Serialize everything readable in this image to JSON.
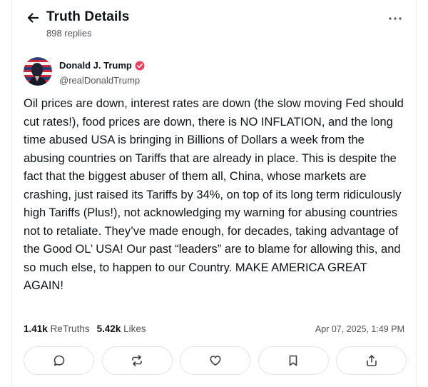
{
  "header": {
    "title": "Truth Details",
    "replies": "898 replies"
  },
  "author": {
    "name": "Donald J. Trump",
    "handle": "@realDonaldTrump",
    "verified": true
  },
  "post": {
    "text": "Oil prices are down, interest rates are down (the slow moving Fed should cut rates!), food prices are down, there is NO INFLATION, and the long time abused USA is bringing in Billions of Dollars a week from the abusing countries on Tariffs that are already in place. This is despite the fact that the biggest abuser of them all, China, whose markets are crashing, just raised its Tariffs by 34%, on top of its long term ridiculously high Tariffs (Plus!), not acknowledging my warning for abusing countries not to retaliate. They’ve made enough, for decades, taking advantage of the Good OL’ USA! Our past “leaders” are to blame for allowing this, and so much else, to happen to our Country. MAKE AMERICA GREAT AGAIN!"
  },
  "stats": {
    "retruths_count": "1.41k",
    "retruths_label": "ReTruths",
    "likes_count": "5.42k",
    "likes_label": "Likes",
    "date": "Apr 07, 2025, 1:49 PM"
  },
  "actions": [
    {
      "icon": "reply-icon"
    },
    {
      "icon": "retruth-icon"
    },
    {
      "icon": "heart-icon"
    },
    {
      "icon": "bookmark-icon"
    },
    {
      "icon": "share-icon"
    }
  ],
  "colors": {
    "text": "#0f1419",
    "muted": "#52525b",
    "border": "#e4e4e7",
    "verified": "#e5455d"
  }
}
